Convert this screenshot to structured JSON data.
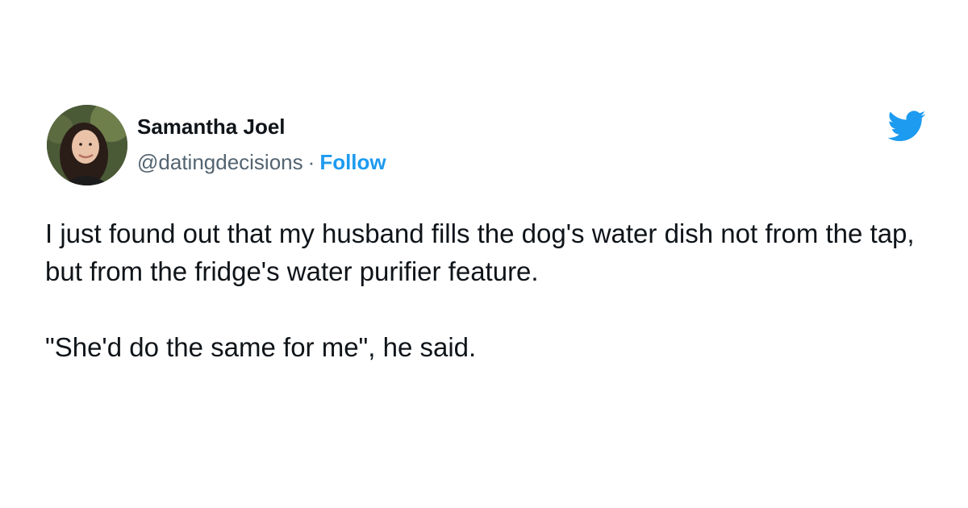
{
  "author": {
    "name": "Samantha Joel",
    "handle": "@datingdecisions",
    "separator": "·",
    "follow_label": "Follow",
    "avatar_icon": "user-avatar-photo"
  },
  "brand": {
    "icon": "twitter-bird-icon",
    "color": "#1d9bf0"
  },
  "tweet": {
    "paragraph_1": "I just found out that my husband fills the dog's water dish not from the tap, but from the fridge's water purifier feature.",
    "paragraph_2": "\"She'd do the same for me\", he said."
  },
  "colors": {
    "text": "#0f1419",
    "secondary_text": "#536471",
    "accent": "#1d9bf0",
    "background": "#ffffff"
  }
}
